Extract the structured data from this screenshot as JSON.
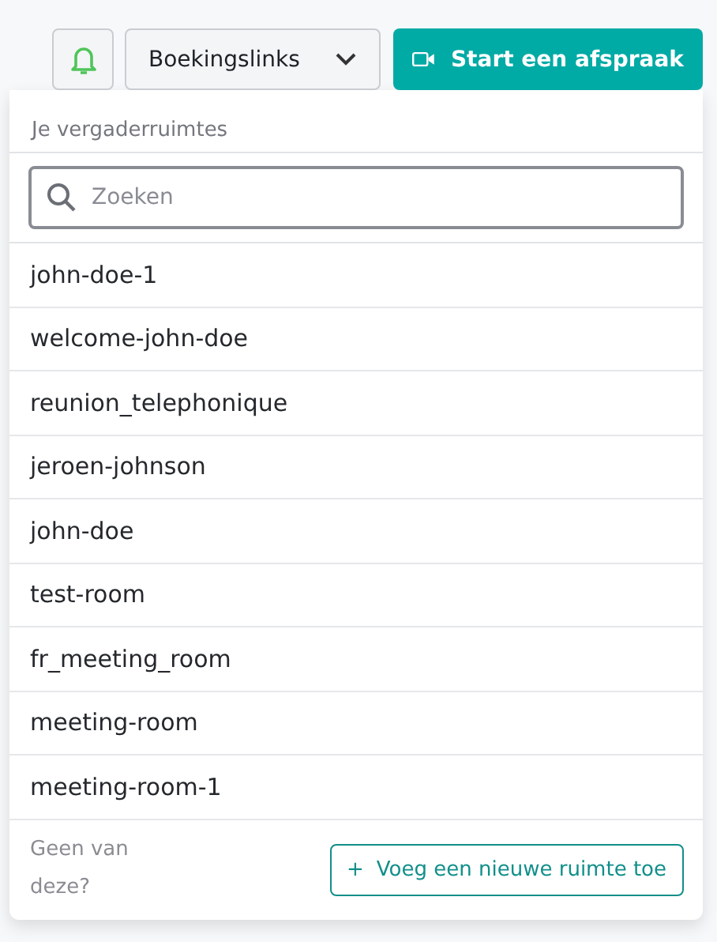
{
  "toolbar": {
    "bell": {
      "kind": "bell"
    },
    "booking_links": {
      "label": "Boekingslinks"
    },
    "start_button": {
      "label": "Start een afspraak"
    }
  },
  "dropdown": {
    "heading": "Je vergaderruimtes",
    "search": {
      "placeholder": "Zoeken"
    },
    "rooms": [
      "john-doe-1",
      "welcome-john-doe",
      "reunion_telephonique",
      "jeroen-johnson",
      "john-doe",
      "test-room",
      "fr_meeting_room",
      "meeting-room",
      "meeting-room-1"
    ],
    "footer": {
      "text": "Geen van deze?",
      "add_button": {
        "icon": "+",
        "label": "Voeg een nieuwe ruimte toe"
      }
    }
  }
}
